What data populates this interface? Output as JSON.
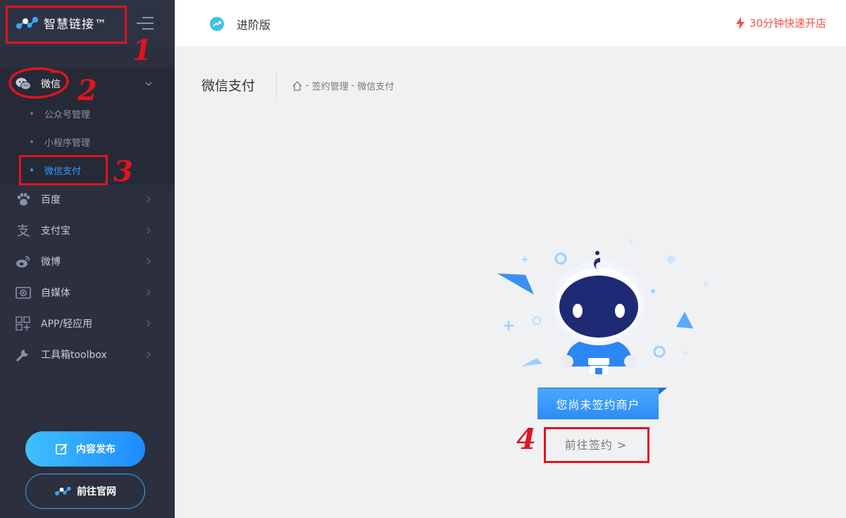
{
  "app": {
    "name": "智慧链接™"
  },
  "header": {
    "edition": "进阶版",
    "quick_open": "30分钟快速开店"
  },
  "sidebar": {
    "wechat": {
      "label": "微信",
      "subitems": [
        {
          "label": "公众号管理",
          "active": false
        },
        {
          "label": "小程序管理",
          "active": false
        },
        {
          "label": "微信支付",
          "active": true
        }
      ]
    },
    "items": [
      {
        "label": "百度",
        "icon": "paw-icon"
      },
      {
        "label": "支付宝",
        "icon": "alipay-icon"
      },
      {
        "label": "微博",
        "icon": "weibo-icon"
      },
      {
        "label": "自媒体",
        "icon": "media-icon"
      },
      {
        "label": "APP/轻应用",
        "icon": "app-grid-icon"
      },
      {
        "label": "工具箱toolbox",
        "icon": "wrench-icon"
      }
    ],
    "buttons": {
      "publish": "内容发布",
      "website": "前往官网"
    }
  },
  "content": {
    "title": "微信支付",
    "breadcrumb": [
      "签约管理",
      "微信支付"
    ],
    "breadcrumb_sep": "-",
    "empty_state": "您尚未签约商户",
    "action": "前往签约 >"
  },
  "annotations": [
    "1",
    "2",
    "3",
    "4"
  ],
  "colors": {
    "sidebar_bg": "#2b2f3e",
    "accent": "#2f9bff",
    "alert": "#f5504a",
    "annotation": "#e0141e"
  }
}
